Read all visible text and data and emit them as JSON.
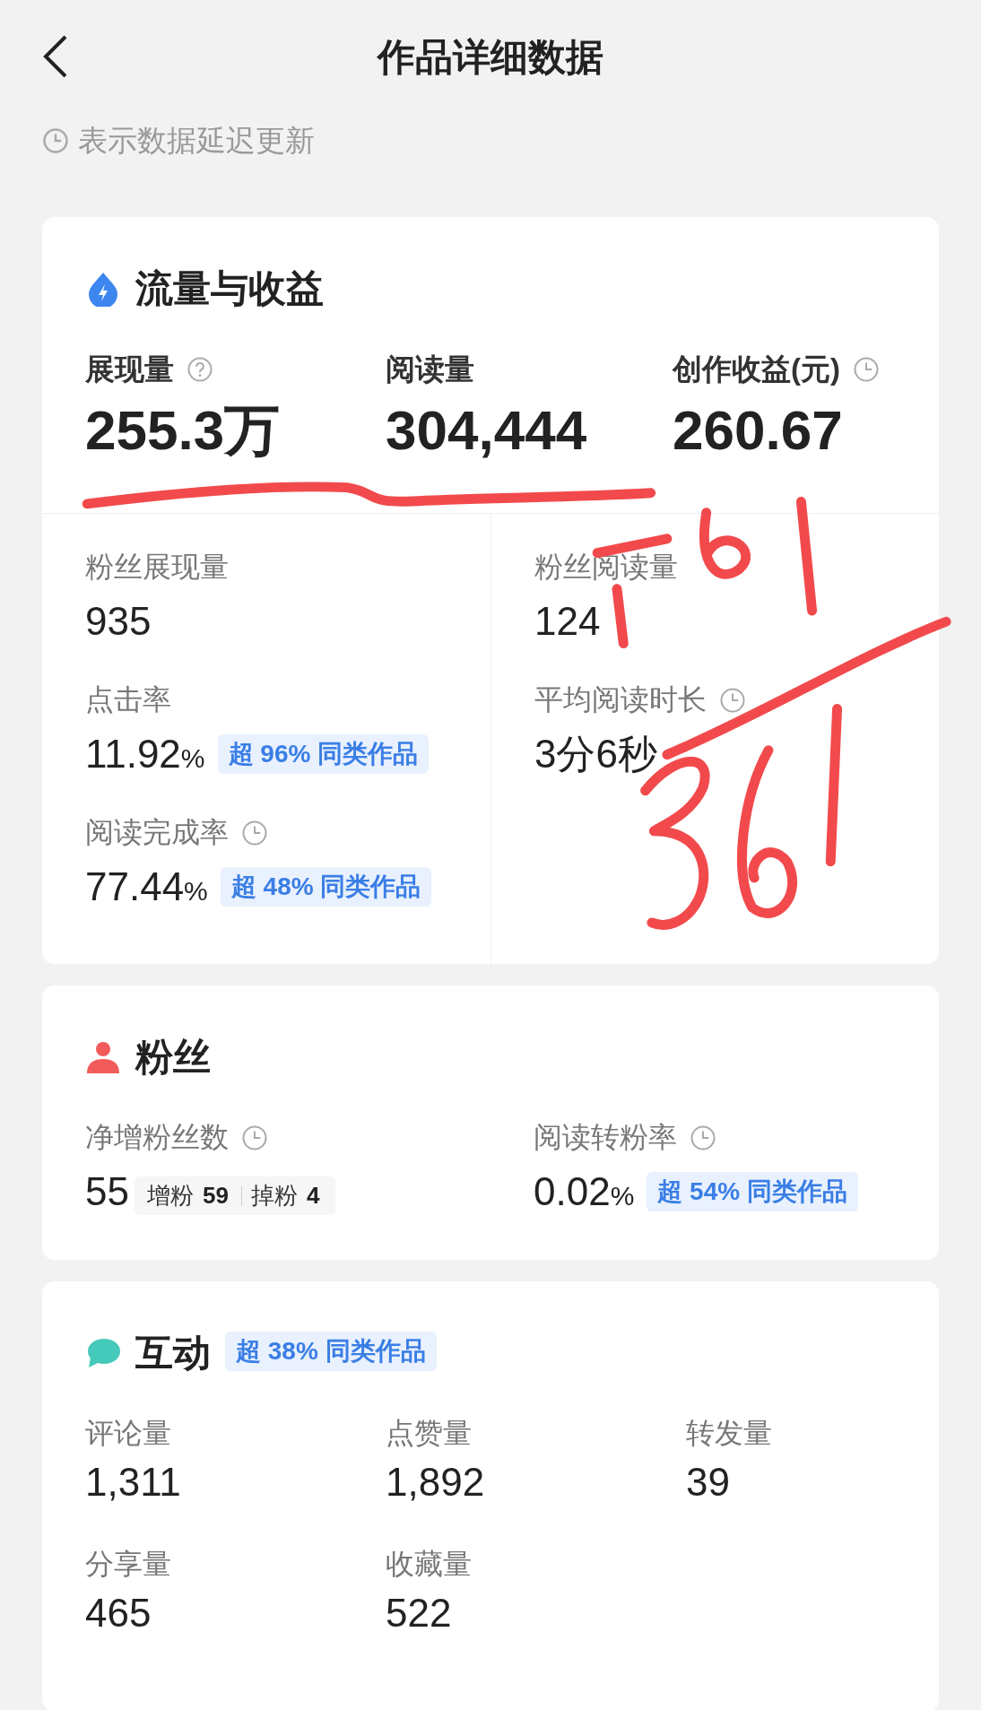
{
  "header": {
    "title": "作品详细数据"
  },
  "delay_note": {
    "text": "表示数据延迟更新"
  },
  "traffic": {
    "title": "流量与收益",
    "headline": [
      {
        "label": "展现量",
        "help_icon": true,
        "value": "255.3万"
      },
      {
        "label": "阅读量",
        "value": "304,444"
      },
      {
        "label": "创作收益(元)",
        "delayed": true,
        "value": "260.67"
      }
    ],
    "columns": [
      [
        {
          "label": "粉丝展现量",
          "value": "935"
        },
        {
          "label": "点击率",
          "value": "11.92",
          "unit": "%",
          "badge": "超 96% 同类作品"
        },
        {
          "label": "阅读完成率",
          "delayed": true,
          "value": "77.44",
          "unit": "%",
          "badge": "超 48% 同类作品"
        }
      ],
      [
        {
          "label": "粉丝阅读量",
          "value": "124"
        },
        {
          "label": "平均阅读时长",
          "delayed": true,
          "value": "3分6秒"
        }
      ]
    ]
  },
  "fans": {
    "title": "粉丝",
    "metrics": [
      {
        "label": "净增粉丝数",
        "delayed": true,
        "value": "55",
        "breakdown": [
          {
            "label": "增粉",
            "value": "59"
          },
          {
            "label": "掉粉",
            "value": "4"
          }
        ]
      },
      {
        "label": "阅读转粉率",
        "delayed": true,
        "value": "0.02",
        "unit": "%",
        "badge": "超 54% 同类作品"
      }
    ]
  },
  "interaction": {
    "title": "互动",
    "badge": "超 38% 同类作品",
    "metrics": [
      {
        "label": "评论量",
        "value": "1,311"
      },
      {
        "label": "点赞量",
        "value": "1,892"
      },
      {
        "label": "转发量",
        "value": "39"
      },
      {
        "label": "分享量",
        "value": "465"
      },
      {
        "label": "收藏量",
        "value": "522"
      }
    ]
  }
}
